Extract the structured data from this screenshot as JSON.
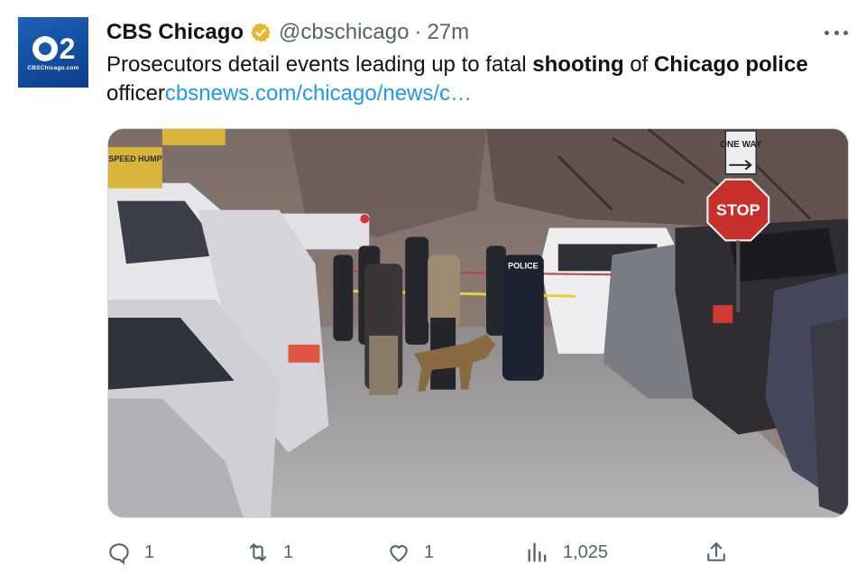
{
  "account": {
    "name": "CBS Chicago",
    "handle": "@cbschicago",
    "separator": "·",
    "time": "27m",
    "avatar_number": "2",
    "avatar_site": "CBSChicago.com",
    "verified_color": "#e8b530"
  },
  "tweet": {
    "text_1": "Prosecutors detail events leading up to fatal ",
    "bold_1": "shooting",
    "text_2": " of ",
    "bold_2": "Chicago police",
    "text_3": " officer",
    "link": "cbsnews.com/chicago/news/c…"
  },
  "media": {
    "sign_speed": "SPEED HUMP",
    "sign_one_way": "ONE WAY",
    "sign_stop": "STOP",
    "vest_label": "POLICE"
  },
  "actions": {
    "reply_count": "1",
    "retweet_count": "1",
    "like_count": "1",
    "views_count": "1,025"
  },
  "colors": {
    "link": "#1d9bf0",
    "muted": "#536471",
    "text": "#0f1419"
  },
  "icons": [
    "reply-icon",
    "retweet-icon",
    "like-icon",
    "views-icon",
    "share-icon",
    "more-icon",
    "verified-icon"
  ]
}
